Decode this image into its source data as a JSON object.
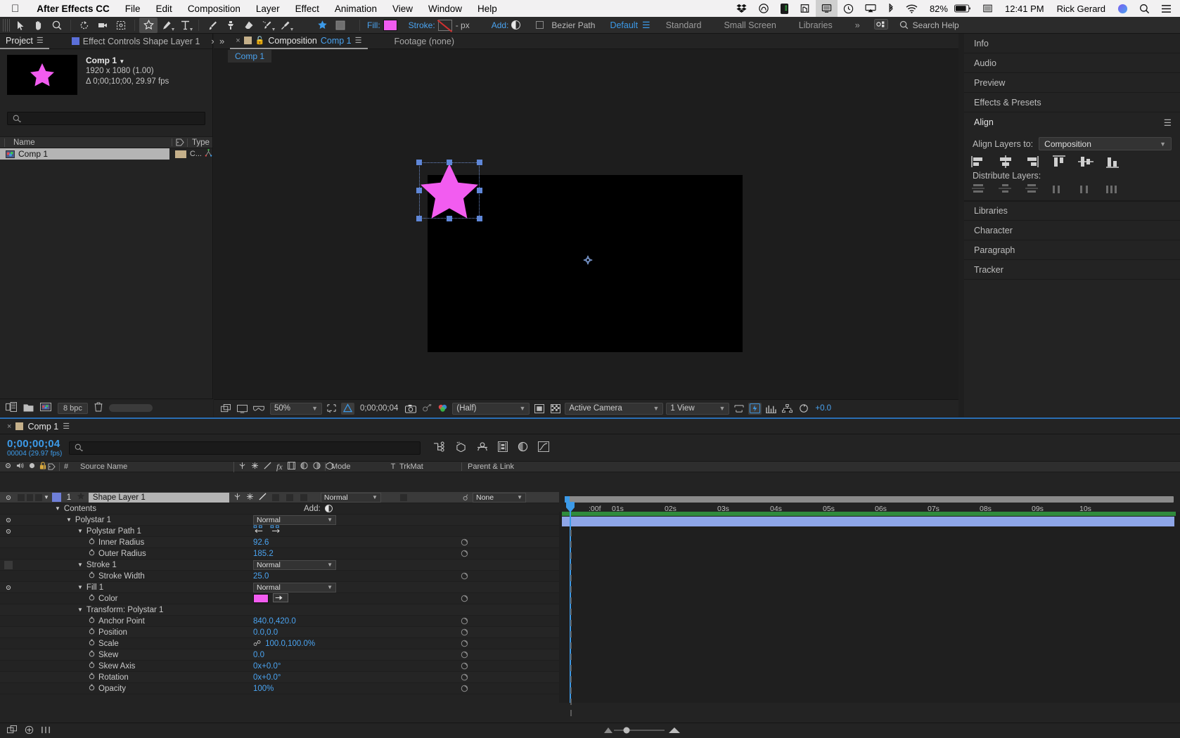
{
  "macmenu": {
    "apple_icon": "apple-icon",
    "items": [
      "After Effects CC",
      "File",
      "Edit",
      "Composition",
      "Layer",
      "Effect",
      "Animation",
      "View",
      "Window",
      "Help"
    ],
    "status_icons": [
      "dropbox-icon",
      "creative-cloud-icon",
      "battery-health-icon",
      "evernote-icon",
      "display-icon",
      "time-machine-icon",
      "airplay-icon",
      "bluetooth-icon",
      "wifi-icon"
    ],
    "battery": "82%",
    "keyboard_icon": "input-source-icon",
    "time": "12:41 PM",
    "user": "Rick Gerard",
    "spotlight_icon": "search-icon",
    "notifications_icon": "notification-center-icon"
  },
  "toolbar": {
    "tools": [
      "selection-tool",
      "hand-tool",
      "zoom-tool",
      "rotation-tool",
      "camera-tool",
      "pan-behind-tool",
      "shape-tool",
      "pen-tool",
      "type-tool",
      "brush-tool",
      "clone-stamp-tool",
      "eraser-tool",
      "roto-brush-tool",
      "puppet-pin-tool"
    ],
    "selected_tool": "shape-tool",
    "star_icon": "star-shape-icon",
    "mask_icon": "mask-icon",
    "fill_label": "Fill:",
    "fill_color": "#f25cf0",
    "stroke_label": "Stroke:",
    "stroke_none": true,
    "stroke_width": "- px",
    "add_label": "Add:",
    "bezier_label": "Bezier Path",
    "workspaces": [
      "Default",
      "Standard",
      "Small Screen",
      "Libraries"
    ],
    "active_workspace": "Default",
    "overflow": "»",
    "search_help": "Search Help"
  },
  "project": {
    "tabs": [
      {
        "label": "Project",
        "active": true,
        "icon": "none"
      },
      {
        "label": "Effect Controls Shape Layer 1",
        "active": false,
        "icon": "blue-square-icon"
      }
    ],
    "item_name": "Comp 1",
    "dimensions": "1920 x 1080 (1.00)",
    "duration": "Δ 0;00;10;00, 29.97 fps",
    "search_placeholder": "",
    "columns": [
      "Name",
      "",
      "Type"
    ],
    "rows": [
      {
        "name": "Comp 1",
        "label_color": "#c5b08a",
        "type": "C..."
      }
    ],
    "bit_depth": "8 bpc",
    "footer_icons": [
      "interpret-footage-icon",
      "new-folder-icon",
      "new-comp-icon",
      "delete-icon"
    ]
  },
  "composition": {
    "tabs": [
      {
        "label": "Composition",
        "name": "Comp 1",
        "active": true
      },
      {
        "label": "Footage (none)",
        "name": "",
        "active": false
      }
    ],
    "subtab": "Comp 1",
    "canvas_bg": "#000000",
    "star_color": "#f25cf0",
    "footer": {
      "zoom": "50%",
      "timecode": "0;00;00;04",
      "resolution": "(Half)",
      "camera": "Active Camera",
      "views": "1 View",
      "exposure": "+0.0",
      "icons": [
        "toggle-transparency-grid-icon",
        "toggle-mask-paths-icon",
        "toggle-3d-view-icon",
        "region-of-interest-icon",
        "grid-guides-icon",
        "take-snapshot-icon",
        "show-snapshot-icon",
        "show-channel-icon",
        "toggle-pixel-aspect-icon",
        "fast-previews-icon",
        "timeline-icon",
        "comp-flowchart-icon",
        "reset-exposure-icon"
      ]
    }
  },
  "right_panels": [
    {
      "label": "Info",
      "type": "collapsed"
    },
    {
      "label": "Audio",
      "type": "collapsed"
    },
    {
      "label": "Preview",
      "type": "collapsed"
    },
    {
      "label": "Effects & Presets",
      "type": "collapsed"
    },
    {
      "label": "Align",
      "type": "expanded"
    },
    {
      "label": "Libraries",
      "type": "collapsed"
    },
    {
      "label": "Character",
      "type": "collapsed"
    },
    {
      "label": "Paragraph",
      "type": "collapsed"
    },
    {
      "label": "Tracker",
      "type": "collapsed"
    }
  ],
  "align_panel": {
    "title": "Align",
    "align_layers_label": "Align Layers to:",
    "align_layers_value": "Composition",
    "align_icons": [
      "align-left-icon",
      "align-horizontal-center-icon",
      "align-right-icon",
      "align-top-icon",
      "align-vertical-center-icon",
      "align-bottom-icon"
    ],
    "distribute_label": "Distribute Layers:",
    "distribute_icons": [
      "distribute-top-icon",
      "distribute-vertical-center-icon",
      "distribute-bottom-icon",
      "distribute-left-icon",
      "distribute-horizontal-center-icon",
      "distribute-right-icon"
    ]
  },
  "timeline": {
    "tab_label": "Comp 1",
    "current_time": "0;00;00;04",
    "current_frame": "00004 (29.97 fps)",
    "search_placeholder": "",
    "switch_icons": [
      "composition-mini-flowchart-icon",
      "draft-3d-icon",
      "hide-shy-layers-icon",
      "frame-blending-icon",
      "motion-blur-icon",
      "graph-editor-icon"
    ],
    "columns": {
      "source_name": "Source Name",
      "num": "#",
      "mode": "Mode",
      "t": "T",
      "trkmat": "TrkMat",
      "parent": "Parent & Link"
    },
    "layer": {
      "index": "1",
      "name": "Shape Layer 1",
      "mode": "Normal",
      "parent": "None",
      "color": "#6f7fd8"
    },
    "properties": [
      {
        "indent": 1,
        "twirl": true,
        "name": "Contents",
        "value": "",
        "type": "group",
        "extra": "Add:",
        "eye": false
      },
      {
        "indent": 2,
        "twirl": true,
        "name": "Polystar 1",
        "value": "Normal",
        "type": "dropdown",
        "eye": true
      },
      {
        "indent": 3,
        "twirl": true,
        "name": "Polystar Path 1",
        "value": "",
        "type": "direction",
        "eye": true
      },
      {
        "indent": 4,
        "twirl": false,
        "name": "Inner Radius",
        "value": "92.6",
        "type": "number",
        "stopwatch": true
      },
      {
        "indent": 4,
        "twirl": false,
        "name": "Outer Radius",
        "value": "185.2",
        "type": "number",
        "stopwatch": true
      },
      {
        "indent": 3,
        "twirl": true,
        "name": "Stroke 1",
        "value": "Normal",
        "type": "dropdown",
        "eye": false,
        "eyebox": true
      },
      {
        "indent": 4,
        "twirl": false,
        "name": "Stroke Width",
        "value": "25.0",
        "type": "number",
        "stopwatch": true
      },
      {
        "indent": 3,
        "twirl": true,
        "name": "Fill 1",
        "value": "Normal",
        "type": "dropdown",
        "eye": true
      },
      {
        "indent": 4,
        "twirl": false,
        "name": "Color",
        "value": "",
        "type": "color",
        "color": "#f25cf0",
        "stopwatch": true
      },
      {
        "indent": 3,
        "twirl": true,
        "name": "Transform: Polystar 1",
        "value": "",
        "type": "group"
      },
      {
        "indent": 4,
        "twirl": false,
        "name": "Anchor Point",
        "value": "840.0,420.0",
        "type": "number",
        "stopwatch": true
      },
      {
        "indent": 4,
        "twirl": false,
        "name": "Position",
        "value": "0.0,0.0",
        "type": "number",
        "stopwatch": true
      },
      {
        "indent": 4,
        "twirl": false,
        "name": "Scale",
        "value": "100.0,100.0%",
        "type": "number",
        "link": true,
        "stopwatch": true
      },
      {
        "indent": 4,
        "twirl": false,
        "name": "Skew",
        "value": "0.0",
        "type": "number",
        "stopwatch": true
      },
      {
        "indent": 4,
        "twirl": false,
        "name": "Skew Axis",
        "value": "0x+0.0°",
        "type": "number",
        "stopwatch": true
      },
      {
        "indent": 4,
        "twirl": false,
        "name": "Rotation",
        "value": "0x+0.0°",
        "type": "number",
        "stopwatch": true
      },
      {
        "indent": 4,
        "twirl": false,
        "name": "Opacity",
        "value": "100%",
        "type": "number",
        "stopwatch": true
      }
    ],
    "ruler_ticks": [
      "01s",
      "02s",
      "03s",
      "04s",
      "05s",
      "06s",
      "07s",
      "08s",
      "09s",
      "10s"
    ],
    "ruler_start": ":00f",
    "footer_icons": [
      "toggle-switches-modes-icon",
      "expand-collapse-icon",
      "motion-blur-toggle-icon"
    ]
  }
}
